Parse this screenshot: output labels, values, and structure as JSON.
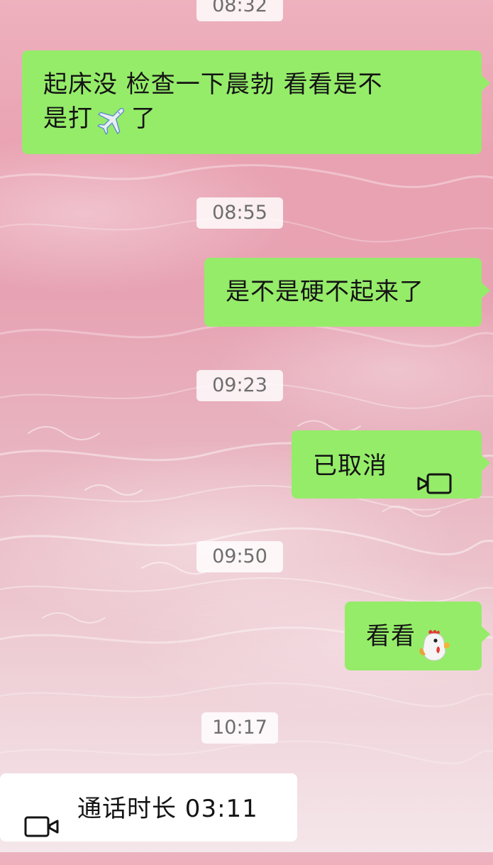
{
  "conversation": {
    "messages": [
      {
        "kind": "timestamp",
        "text": "08:32"
      },
      {
        "kind": "text",
        "side": "right",
        "text_line1": "起床没  检查一下晨勃  看看是不",
        "text_line2_prefix": "是打",
        "emoji": "airplane-icon",
        "text_line2_suffix": "了"
      },
      {
        "kind": "timestamp",
        "text": "08:55"
      },
      {
        "kind": "text",
        "side": "right",
        "text": "是不是硬不起来了"
      },
      {
        "kind": "timestamp",
        "text": "09:23"
      },
      {
        "kind": "video-call",
        "side": "right",
        "text": "已取消",
        "icon": "video-camera-icon"
      },
      {
        "kind": "timestamp",
        "text": "09:50"
      },
      {
        "kind": "text",
        "side": "right",
        "text": "看看",
        "emoji": "rooster-icon"
      },
      {
        "kind": "timestamp",
        "text": "10:17"
      },
      {
        "kind": "video-call",
        "side": "left",
        "text": "通话时长 03:11",
        "icon": "video-camera-icon"
      }
    ]
  },
  "colors": {
    "bubble_sent": "#95ec69",
    "bubble_received": "#ffffff",
    "timestamp_bg": "#ffffff",
    "timestamp_text": "#6e6e6e",
    "message_text": "#141414",
    "background": "#e9a9b7"
  }
}
